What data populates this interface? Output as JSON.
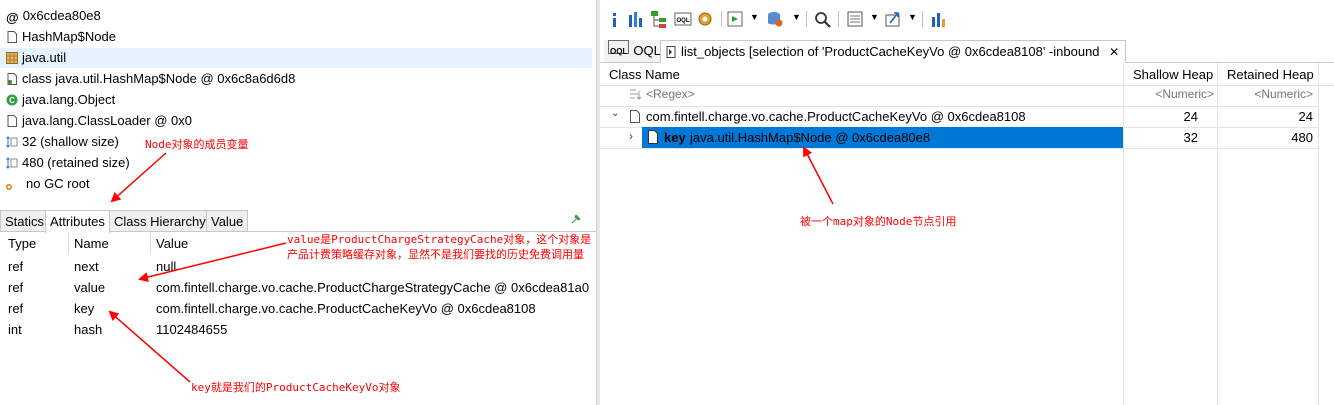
{
  "left_panel": {
    "tree": [
      {
        "icon": "at-icon",
        "text": "0x6cdea80e8"
      },
      {
        "icon": "class-file-icon",
        "text": "HashMap$Node"
      },
      {
        "icon": "package-icon",
        "text": "java.util"
      },
      {
        "icon": "class-file-icon",
        "text": "class java.util.HashMap$Node @ 0x6c8a6d6d8"
      },
      {
        "icon": "superclass-icon",
        "text": "java.lang.Object"
      },
      {
        "icon": "class-file-icon",
        "text": "java.lang.ClassLoader @ 0x0"
      },
      {
        "icon": "size-icon",
        "text": "32 (shallow size)"
      },
      {
        "icon": "size-icon",
        "text": "480 (retained size)"
      },
      {
        "icon": "gc-root-icon",
        "text": "no GC root"
      }
    ],
    "tabs": [
      "Statics",
      "Attributes",
      "Class Hierarchy",
      "Value"
    ],
    "active_tab": "Attributes",
    "columns": [
      "Type",
      "Name",
      "Value"
    ],
    "rows": [
      {
        "type": "ref",
        "name": "next",
        "value": "null"
      },
      {
        "type": "ref",
        "name": "value",
        "value": "com.fintell.charge.vo.cache.ProductChargeStrategyCache @ 0x6cdea81a0"
      },
      {
        "type": "ref",
        "name": "key",
        "value": "com.fintell.charge.vo.cache.ProductCacheKeyVo @ 0x6cdea8108"
      },
      {
        "type": "int",
        "name": "hash",
        "value": "1102484655"
      }
    ]
  },
  "annotations": {
    "node_members": "Node对象的成员变量",
    "value_line1": "value是ProductChargeStrategyCache对象，这个对象是",
    "value_line2": "产品计费策略缓存对象，显然不是我们要找的历史免费调用量",
    "key_note": "key就是我们的ProductCacheKeyVo对象",
    "map_ref": "被一个map对象的Node节点引用"
  },
  "right_panel": {
    "tabs": [
      {
        "label": "OQL",
        "active": false
      },
      {
        "label": "list_objects [selection of 'ProductCacheKeyVo @ 0x6cdea8108' -inbound",
        "active": true
      }
    ],
    "columns": [
      "Class Name",
      "Shallow Heap",
      "Retained Heap"
    ],
    "filter": {
      "name": "<Regex>",
      "shallow": "<Numeric>",
      "retained": "<Numeric>"
    },
    "rows": [
      {
        "name": "com.fintell.charge.vo.cache.ProductCacheKeyVo @ 0x6cdea8108",
        "shallow": "24",
        "retained": "24",
        "selected": false
      },
      {
        "field": "key",
        "name": "java.util.HashMap$Node @ 0x6cdea80e8",
        "shallow": "32",
        "retained": "480",
        "selected": true
      }
    ]
  },
  "colors": {
    "selection": "#0078d7",
    "annotation": "#ff0000",
    "header_bg": "#ffffff",
    "grid": "#e3e3e3"
  }
}
